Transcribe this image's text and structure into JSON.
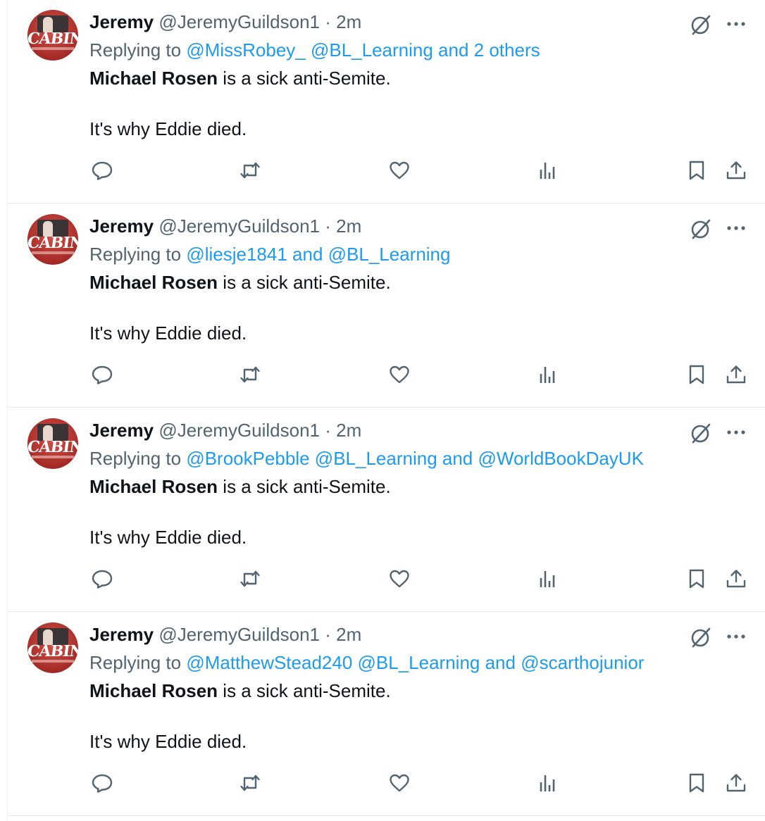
{
  "colors": {
    "mention": "#1d9bf0",
    "secondary_text": "#536471",
    "primary_text": "#0f1419",
    "icon": "#536471"
  },
  "tweets": [
    {
      "name": "Jeremy",
      "handle": "@JeremyGuildson1",
      "separator": "·",
      "time": "2m",
      "replying_prefix": "Replying to",
      "replying_targets": "@MissRobey_ @BL_Learning and 2 others",
      "body_bold": "Michael Rosen",
      "body_rest": " is a sick anti-Semite.",
      "body_line2": "It's why Eddie died."
    },
    {
      "name": "Jeremy",
      "handle": "@JeremyGuildson1",
      "separator": "·",
      "time": "2m",
      "replying_prefix": "Replying to",
      "replying_targets": "@liesje1841 and @BL_Learning",
      "body_bold": "Michael Rosen",
      "body_rest": " is a sick anti-Semite.",
      "body_line2": "It's why Eddie died."
    },
    {
      "name": "Jeremy",
      "handle": "@JeremyGuildson1",
      "separator": "·",
      "time": "2m",
      "replying_prefix": "Replying to",
      "replying_targets": "@BrookPebble @BL_Learning and @WorldBookDayUK",
      "body_bold": "Michael Rosen",
      "body_rest": " is a sick anti-Semite.",
      "body_line2": "It's why Eddie died."
    },
    {
      "name": "Jeremy",
      "handle": "@JeremyGuildson1",
      "separator": "·",
      "time": "2m",
      "replying_prefix": "Replying to",
      "replying_targets": "@MatthewStead240 @BL_Learning and @scarthojunior",
      "body_bold": "Michael Rosen",
      "body_rest": " is a sick anti-Semite.",
      "body_line2": "It's why Eddie died."
    }
  ],
  "avatar": {
    "logo_text": "CABINET"
  },
  "icons": {
    "top": [
      "grok-icon",
      "more-icon"
    ],
    "actions": [
      "reply-icon",
      "retweet-icon",
      "like-icon",
      "views-icon",
      "bookmark-icon",
      "share-icon"
    ]
  }
}
